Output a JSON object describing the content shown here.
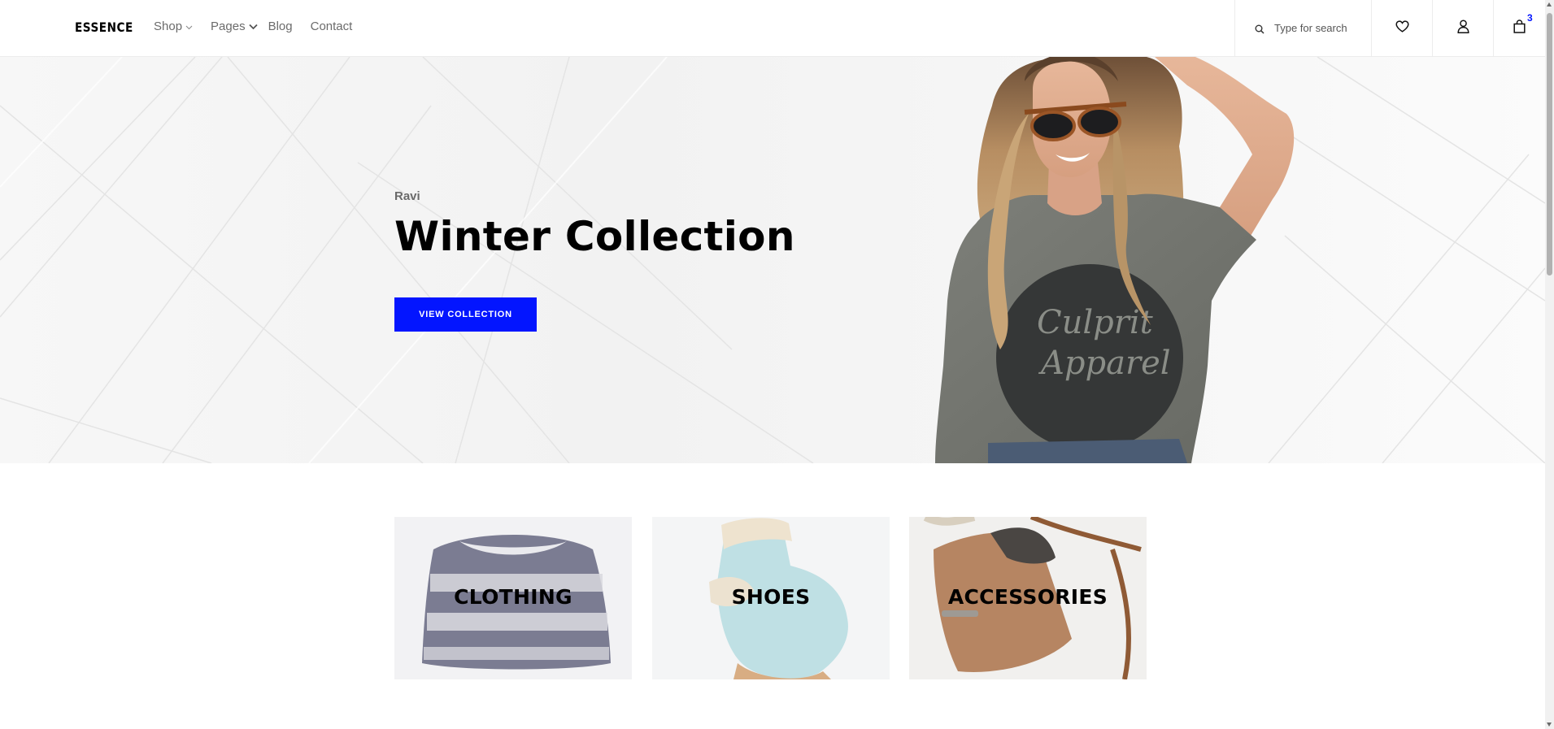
{
  "header": {
    "logo": "ESSENCE",
    "nav": [
      {
        "label": "Shop",
        "has_dropdown": true
      },
      {
        "label": "Pages",
        "has_dropdown": true
      },
      {
        "label": "Blog",
        "has_dropdown": false
      },
      {
        "label": "Contact",
        "has_dropdown": false
      }
    ],
    "search": {
      "placeholder": "Type for search",
      "value": ""
    },
    "icons": [
      "search-icon",
      "heart-icon",
      "user-icon",
      "shopping-bag-icon"
    ],
    "cart_count": "3"
  },
  "hero": {
    "subtitle": "Ravi",
    "title": "Winter Collection",
    "button_label": "VIEW COLLECTION",
    "shirt_print": [
      "Culprit",
      "Apparel"
    ]
  },
  "categories": [
    {
      "label": "CLOTHING"
    },
    {
      "label": "SHOES"
    },
    {
      "label": "ACCESSORIES"
    }
  ],
  "colors": {
    "accent": "#0315ff",
    "nav_text": "#6b6b6b",
    "title_text": "#000000"
  }
}
